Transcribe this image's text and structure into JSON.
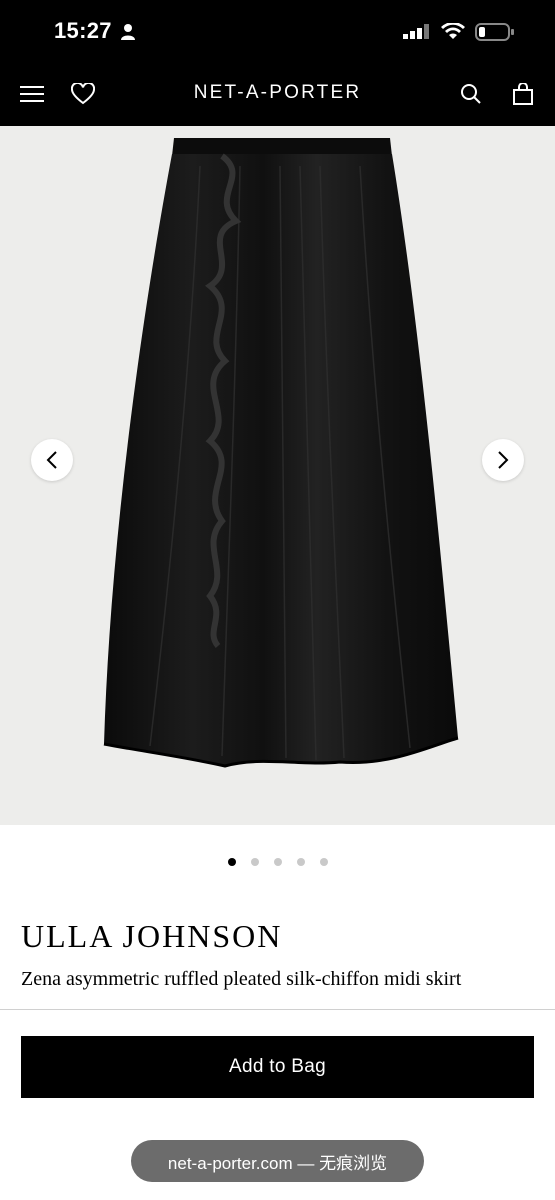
{
  "status_bar": {
    "time": "15:27"
  },
  "nav": {
    "brand": "NET-A-PORTER"
  },
  "gallery": {
    "image_count": 5,
    "active_index": 0
  },
  "product": {
    "designer": "ULLA JOHNSON",
    "name": "Zena asymmetric ruffled pleated silk-chiffon midi skirt"
  },
  "actions": {
    "add_to_bag": "Add to Bag"
  },
  "browser": {
    "url_label": "net-a-porter.com — 无痕浏览"
  },
  "icons": {
    "menu": "menu-icon",
    "wishlist": "heart-icon",
    "search": "search-icon",
    "bag": "shopping-bag-icon",
    "prev": "chevron-left-icon",
    "next": "chevron-right-icon"
  },
  "colors": {
    "header_bg": "#000000",
    "button_bg": "#000000",
    "gallery_bg": "#ededeb"
  }
}
